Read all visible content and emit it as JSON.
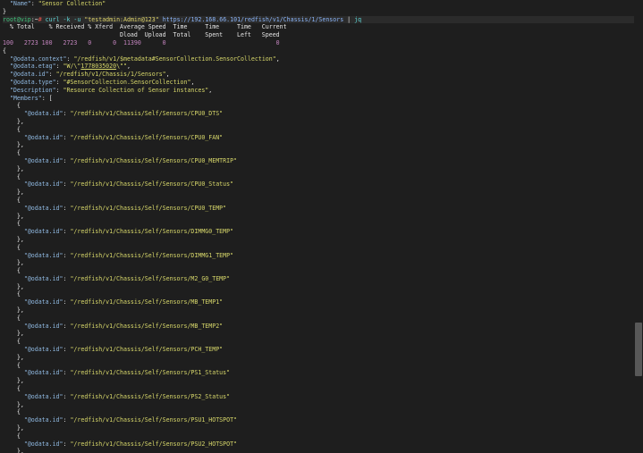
{
  "top": {
    "name_key": "\"Name\"",
    "colon": ": ",
    "name_val": "\"Sensor Collection\"",
    "close": "}"
  },
  "prompt": {
    "user": "root@vip",
    "sep": ":~",
    "sym": "#",
    "cmd": " curl -k -u ",
    "cred": "\"testadmin:Admin@123\"",
    "url": "https://192.168.66.101/redfish/v1/Chassis/1/Sensors",
    "pipe": " | ",
    "jq": "jq"
  },
  "progress": {
    "h1": "  % Total    % Received % Xferd  Average Speed  Time     Time     Time   Current",
    "h2": "                                 Dload  Upload  Total    Spent    Left   Speed",
    "row": "100   2723 100   2723   0      0  11390      0                               0"
  },
  "json": {
    "open": "{",
    "context_key": "\"@odata.context\"",
    "context_val": "\"/redfish/v1/$metadata#SensorCollection.SensorCollection\"",
    "etag_key": "\"@odata.etag\"",
    "etag_pre": "\"W/\\\"",
    "etag_num": "1778035020",
    "etag_post": "\\\"\"",
    "id_key": "\"@odata.id\"",
    "id_val": "\"/redfish/v1/Chassis/1/Sensors\"",
    "type_key": "\"@odata.type\"",
    "type_val": "\"#SensorCollection.SensorCollection\"",
    "desc_key": "\"Description\"",
    "desc_val": "\"Resource Collection of Sensor instances\"",
    "members_key": "\"Members\"",
    "members_open": "["
  },
  "members": [
    "\"/redfish/v1/Chassis/Self/Sensors/CPU0_DTS\"",
    "\"/redfish/v1/Chassis/Self/Sensors/CPU0_FAN\"",
    "\"/redfish/v1/Chassis/Self/Sensors/CPU0_MEMTRIP\"",
    "\"/redfish/v1/Chassis/Self/Sensors/CPU0_Status\"",
    "\"/redfish/v1/Chassis/Self/Sensors/CPU0_TEMP\"",
    "\"/redfish/v1/Chassis/Self/Sensors/DIMMG0_TEMP\"",
    "\"/redfish/v1/Chassis/Self/Sensors/DIMMG1_TEMP\"",
    "\"/redfish/v1/Chassis/Self/Sensors/M2_G0_TEMP\"",
    "\"/redfish/v1/Chassis/Self/Sensors/MB_TEMP1\"",
    "\"/redfish/v1/Chassis/Self/Sensors/MB_TEMP2\"",
    "\"/redfish/v1/Chassis/Self/Sensors/PCH_TEMP\"",
    "\"/redfish/v1/Chassis/Self/Sensors/PS1_Status\"",
    "\"/redfish/v1/Chassis/Self/Sensors/PS2_Status\"",
    "\"/redfish/v1/Chassis/Self/Sensors/PSU1_HOTSPOT\"",
    "\"/redfish/v1/Chassis/Self/Sensors/PSU2_HOTSPOT\""
  ],
  "member_key": "\"@odata.id\"",
  "brace_open": "{",
  "brace_close": "},",
  "colors": {
    "key": "#8fb8e0",
    "string": "#d7d76a",
    "prompt": "#3fc37a",
    "background": "#1e1e1e"
  }
}
